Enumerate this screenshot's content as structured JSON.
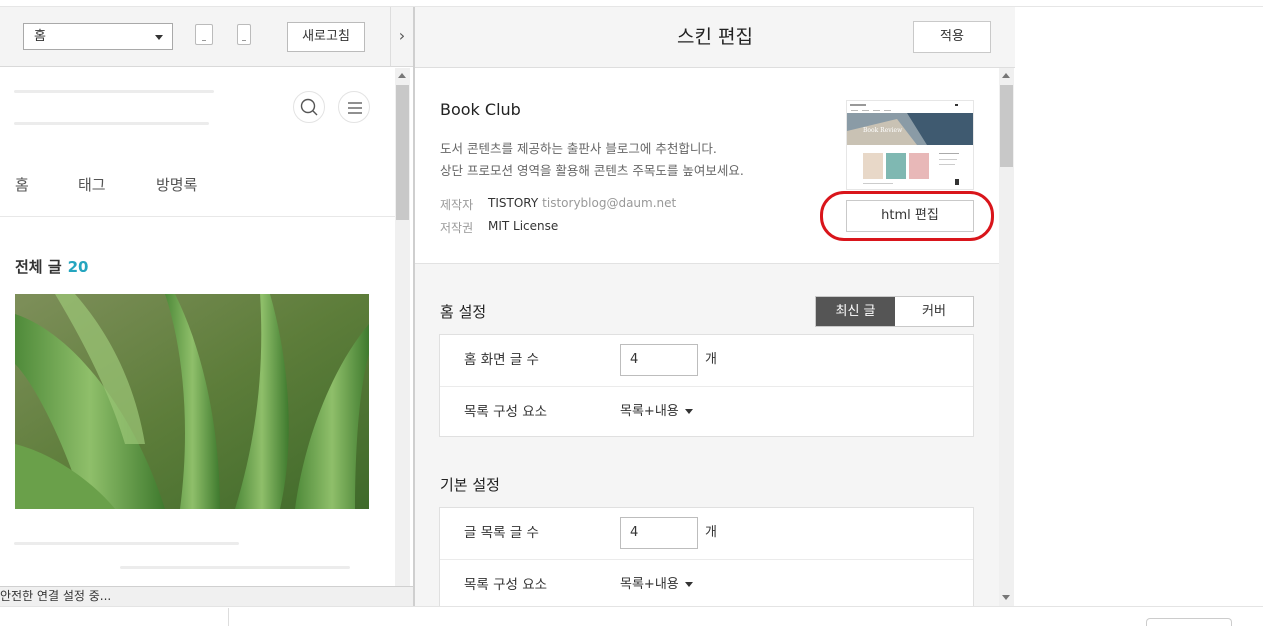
{
  "toolbar": {
    "page_select_value": "홈",
    "refresh_label": "새로고침",
    "collapse_glyph": "›"
  },
  "preview": {
    "nav": [
      "홈",
      "태그",
      "방명록"
    ],
    "all_posts_label": "전체 글",
    "all_posts_count": "20"
  },
  "status_bar": {
    "text": "안전한 연결 설정 중..."
  },
  "editor": {
    "title": "스킨 편집",
    "apply_label": "적용",
    "skin": {
      "name": "Book Club",
      "desc_line1": "도서 콘텐츠를 제공하는 출판사 블로그에 추천합니다.",
      "desc_line2": "상단 프로모션 영역을 활용해 콘텐츠 주목도를 높여보세요.",
      "author_label": "제작자",
      "author_value": "TISTORY",
      "author_email": "tistoryblog@daum.net",
      "license_label": "저작권",
      "license_value": "MIT License",
      "thumb_banner_text": "Book Review",
      "html_edit_label": "html 편집"
    },
    "home_settings": {
      "title": "홈 설정",
      "toggle_active": "최신 글",
      "toggle_inactive": "커버",
      "rows": [
        {
          "label": "홈 화면 글 수",
          "value": "4",
          "unit": "개"
        },
        {
          "label": "목록 구성 요소",
          "value": "목록+내용"
        }
      ]
    },
    "basic_settings": {
      "title": "기본 설정",
      "rows": [
        {
          "label": "글 목록 글 수",
          "value": "4",
          "unit": "개"
        },
        {
          "label": "목록 구성 요소",
          "value": "목록+내용"
        }
      ]
    }
  },
  "colors": {
    "accent_count": "#25a5bf",
    "highlight_circle": "#d9151b",
    "toggle_active_bg": "#555555"
  }
}
